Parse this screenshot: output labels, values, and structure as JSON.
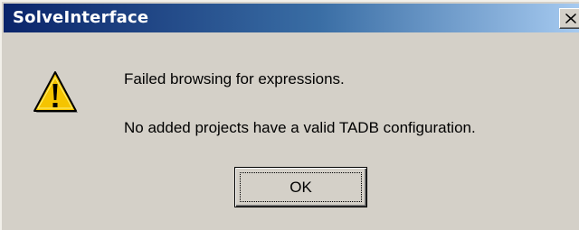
{
  "window": {
    "title": "SolveInterface",
    "close_icon": "close-icon"
  },
  "message": {
    "icon": "warning-icon",
    "line1": "Failed browsing for expressions.",
    "line2": "No added projects have a valid TADB configuration."
  },
  "buttons": {
    "ok_label": "OK"
  },
  "colors": {
    "titlebar_start": "#0a246a",
    "titlebar_end": "#a6caf0",
    "dialog_bg": "#d4d0c8",
    "warning_yellow": "#f5c400"
  }
}
